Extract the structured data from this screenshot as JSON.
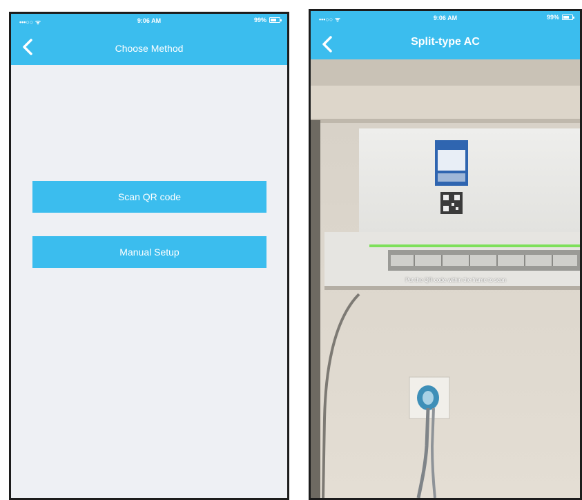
{
  "screens": [
    {
      "status_bar": {
        "carrier": "•••○○ ᯤ",
        "time": "9:06 AM",
        "battery": "99%"
      },
      "title": "Choose Method",
      "buttons": {
        "scan_qr": "Scan QR code",
        "manual_setup": "Manual Setup"
      }
    },
    {
      "status_bar": {
        "carrier": "•••○○ ᯤ",
        "time": "9:06 AM",
        "battery": "99%"
      },
      "title": "Split-type AC",
      "camera_hint": "Put the QR code within the frame to scan"
    }
  ],
  "colors": {
    "accent": "#3bbdee",
    "left_background": "#eef0f4",
    "frame_border": "#1c1c1c",
    "scan_line": "#7ee05a"
  },
  "icons": {
    "back": "chevron-left-icon",
    "battery": "battery-icon",
    "qr": "qr-code-sticker"
  }
}
